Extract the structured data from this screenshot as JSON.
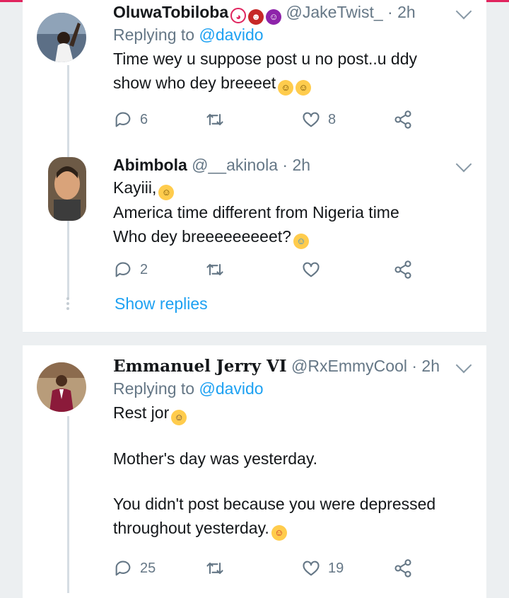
{
  "tweets": [
    {
      "name": "OluwaTobiloba",
      "name_emojis": [
        "clown-face",
        "ogre",
        "smiling-imp"
      ],
      "handle": "@JakeTwist_",
      "time": "· 2h",
      "replying_prefix": "Replying to ",
      "replying_to": "@davido",
      "lines": [
        "Time wey u suppose post u no post..u ddy",
        "show who dey breeeet"
      ],
      "line_emojis": [
        "rolling-on-floor-laughing",
        "rolling-on-floor-laughing"
      ],
      "replies": "6",
      "retweets": "",
      "likes": "8"
    },
    {
      "name": "Abimbola",
      "handle": "@__akinola",
      "time": "· 2h",
      "lines": [
        "Kayiii,",
        "America time different from Nigeria time",
        "Who dey breeeeeeeeet?"
      ],
      "replies": "2",
      "retweets": "",
      "likes": ""
    },
    {
      "name": "Emmanuel Jerry VI",
      "handle": "@RxEmmyCool",
      "time": "· 2h",
      "replying_prefix": "Replying to ",
      "replying_to": "@davido",
      "lines": [
        "Rest jor",
        "Mother's day was yesterday.",
        "You didn't post because you were depressed",
        "throughout yesterday."
      ],
      "replies": "25",
      "retweets": "",
      "likes": "19"
    }
  ],
  "show_replies": "Show replies",
  "colors": {
    "accent": "#1da1f2",
    "muted": "#657786",
    "text": "#14171a",
    "background": "#eceff1",
    "top_bar": "#e0245e"
  },
  "icons": [
    "reply-icon",
    "retweet-icon",
    "like-icon",
    "share-icon",
    "chevron-down-icon"
  ]
}
